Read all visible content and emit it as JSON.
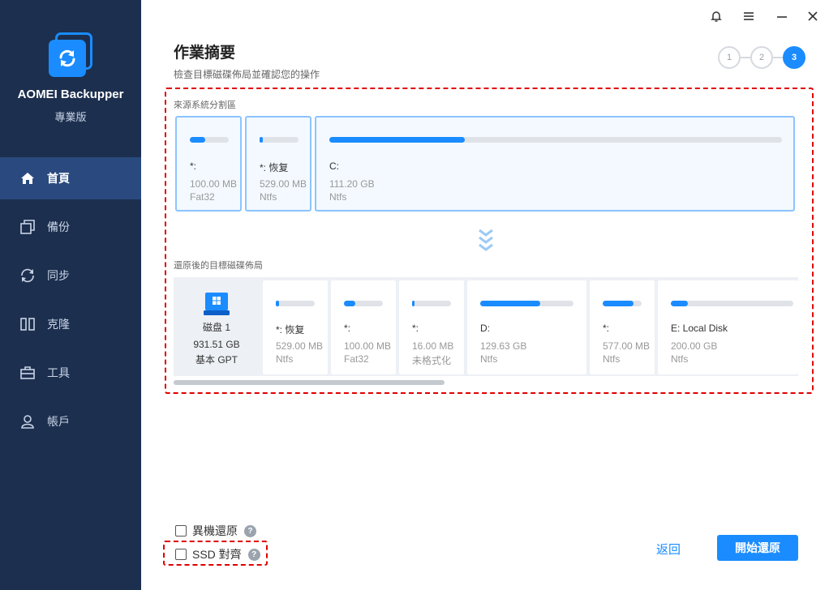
{
  "app": {
    "name": "AOMEI Backupper",
    "edition": "專業版"
  },
  "sidebar": {
    "items": [
      {
        "label": "首頁",
        "icon": "home-icon",
        "active": true
      },
      {
        "label": "備份",
        "icon": "backup-icon",
        "active": false
      },
      {
        "label": "同步",
        "icon": "sync-icon",
        "active": false
      },
      {
        "label": "克隆",
        "icon": "clone-icon",
        "active": false
      },
      {
        "label": "工具",
        "icon": "tools-icon",
        "active": false
      },
      {
        "label": "帳戶",
        "icon": "account-icon",
        "active": false
      }
    ]
  },
  "window": {
    "buttons": [
      "bell-icon",
      "menu-icon",
      "minimize-icon",
      "close-icon"
    ]
  },
  "page": {
    "title": "作業摘要",
    "subtitle": "檢查目標磁碟佈局並確認您的操作",
    "steps": [
      "1",
      "2",
      "3"
    ],
    "active_step": 3
  },
  "source": {
    "label": "來源系統分割區",
    "partitions": [
      {
        "name": "*:",
        "size": "100.00 MB",
        "fs": "Fat32",
        "used_fraction": 0.4
      },
      {
        "name": "*: 恢复",
        "size": "529.00 MB",
        "fs": "Ntfs",
        "used_fraction": 0.08
      },
      {
        "name": "C:",
        "size": "111.20 GB",
        "fs": "Ntfs",
        "used_fraction": 0.3
      }
    ]
  },
  "destination": {
    "label": "還原後的目標磁碟佈局",
    "disk": {
      "name": "磁盘 1",
      "size": "931.51 GB",
      "type": "基本 GPT"
    },
    "partitions": [
      {
        "name": "*: 恢复",
        "size": "529.00 MB",
        "fs": "Ntfs",
        "used_fraction": 0.08
      },
      {
        "name": "*:",
        "size": "100.00 MB",
        "fs": "Fat32",
        "used_fraction": 0.3
      },
      {
        "name": "*:",
        "size": "16.00 MB",
        "fs": "未格式化",
        "used_fraction": 0.06
      },
      {
        "name": "D:",
        "size": "129.63 GB",
        "fs": "Ntfs",
        "used_fraction": 0.64
      },
      {
        "name": "*:",
        "size": "577.00 MB",
        "fs": "Ntfs",
        "used_fraction": 0.8
      },
      {
        "name": "E: Local Disk",
        "size": "200.00 GB",
        "fs": "Ntfs",
        "used_fraction": 0.14
      }
    ]
  },
  "options": {
    "dissimilar_restore": "異機還原",
    "ssd_align": "SSD 對齊"
  },
  "buttons": {
    "back": "返回",
    "start": "開始還原"
  },
  "colors": {
    "sidebar": "#1c2f4e",
    "sidebar_active": "#2a4a7f",
    "accent": "#1a8cff",
    "highlight_frame": "#e00000"
  }
}
